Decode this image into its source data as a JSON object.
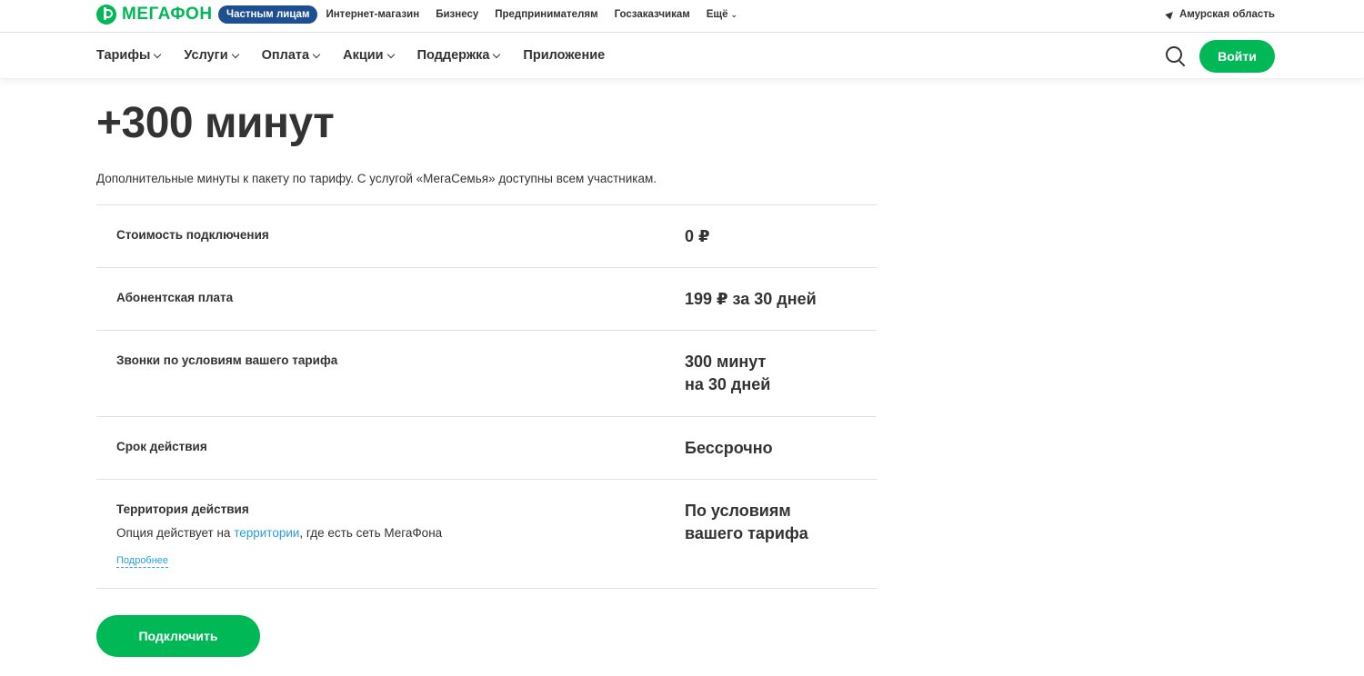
{
  "header": {
    "logo_text": "МегаФон",
    "segments": [
      {
        "label": "Частным лицам",
        "active": true
      },
      {
        "label": "Интернет-магазин",
        "active": false
      },
      {
        "label": "Бизнесу",
        "active": false
      },
      {
        "label": "Предпринимателям",
        "active": false
      },
      {
        "label": "Госзаказчикам",
        "active": false
      },
      {
        "label": "Ещё",
        "active": false
      }
    ],
    "region": "Амурская область"
  },
  "nav": {
    "items": [
      "Тарифы",
      "Услуги",
      "Оплата",
      "Акции",
      "Поддержка",
      "Приложение"
    ],
    "login_label": "Войти"
  },
  "main": {
    "title": "+300 минут",
    "description": "Дополнительные минуты к пакету по тарифу. С услугой «МегаСемья» доступны всем участникам.",
    "rows": [
      {
        "label": "Стоимость подключения",
        "value_line1": "0 ₽",
        "value_line2": ""
      },
      {
        "label": "Абонентская плата",
        "value_line1": "199 ₽ за 30 дней",
        "value_line2": ""
      },
      {
        "label": "Звонки по условиям вашего тарифа",
        "value_line1": "300 минут",
        "value_line2": "на 30 дней"
      },
      {
        "label": "Срок действия",
        "value_line1": "Бессрочно",
        "value_line2": ""
      },
      {
        "label": "Территория действия",
        "value_line1": "По условиям",
        "value_line2": "вашего тарифа"
      }
    ],
    "territory": {
      "sub_before": "Опция действует на ",
      "sub_link": "территории",
      "sub_after": ", где есть сеть МегаФона",
      "more_label": "Подробнее"
    },
    "connect_label": "Подключить"
  },
  "colors": {
    "brand_green": "#00b956",
    "active_segment": "#1d4f91",
    "link": "#2a9fd8"
  }
}
